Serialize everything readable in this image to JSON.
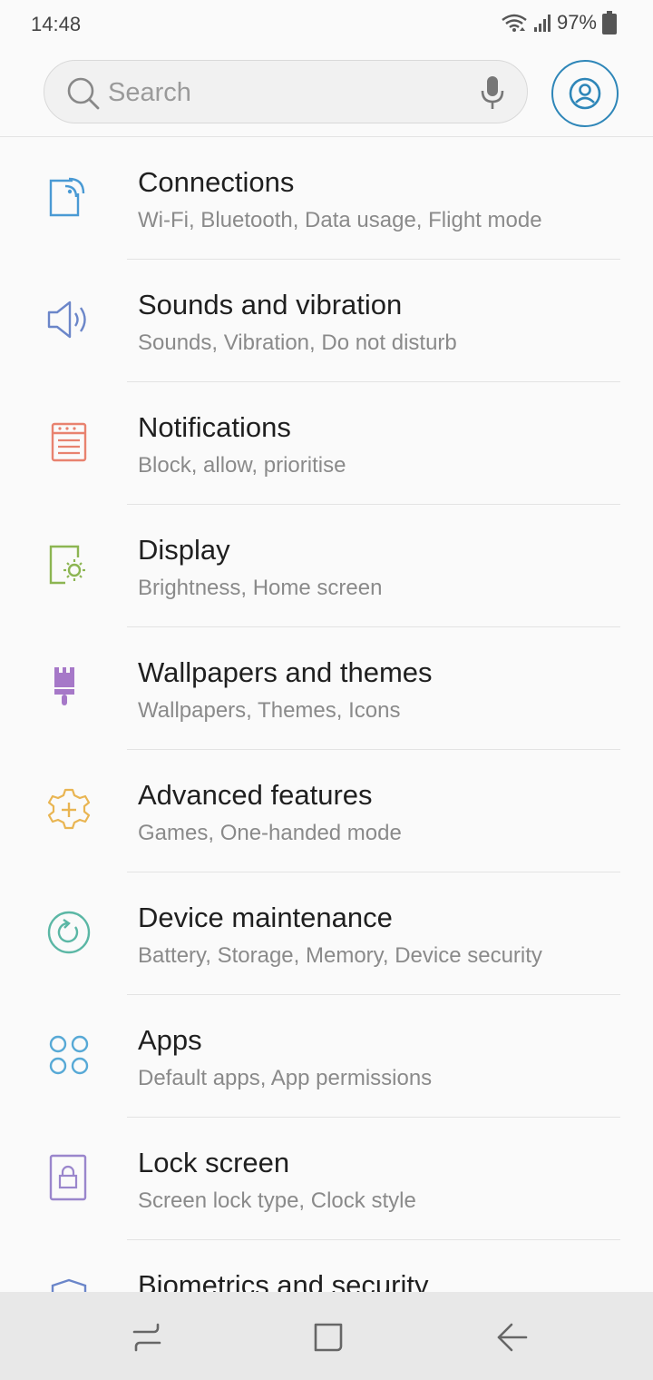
{
  "status": {
    "time": "14:48",
    "battery": "97%"
  },
  "search": {
    "placeholder": "Search"
  },
  "items": [
    {
      "title": "Connections",
      "subtitle": "Wi-Fi, Bluetooth, Data usage, Flight mode",
      "icon": "connections-icon",
      "color": "#4a9ad4"
    },
    {
      "title": "Sounds and vibration",
      "subtitle": "Sounds, Vibration, Do not disturb",
      "icon": "speaker-icon",
      "color": "#6b86c9"
    },
    {
      "title": "Notifications",
      "subtitle": "Block, allow, prioritise",
      "icon": "notifications-icon",
      "color": "#e8826f"
    },
    {
      "title": "Display",
      "subtitle": "Brightness, Home screen",
      "icon": "display-icon",
      "color": "#8cb552"
    },
    {
      "title": "Wallpapers and themes",
      "subtitle": "Wallpapers, Themes, Icons",
      "icon": "brush-icon",
      "color": "#a678c8"
    },
    {
      "title": "Advanced features",
      "subtitle": "Games, One-handed mode",
      "icon": "gear-plus-icon",
      "color": "#e9b552"
    },
    {
      "title": "Device maintenance",
      "subtitle": "Battery, Storage, Memory, Device security",
      "icon": "maintenance-icon",
      "color": "#5bb7a5"
    },
    {
      "title": "Apps",
      "subtitle": "Default apps, App permissions",
      "icon": "apps-icon",
      "color": "#57a9d6"
    },
    {
      "title": "Lock screen",
      "subtitle": "Screen lock type, Clock style",
      "icon": "lock-icon",
      "color": "#9a86cc"
    },
    {
      "title": "Biometrics and security",
      "subtitle": "",
      "icon": "shield-icon",
      "color": "#6b86c9"
    }
  ]
}
